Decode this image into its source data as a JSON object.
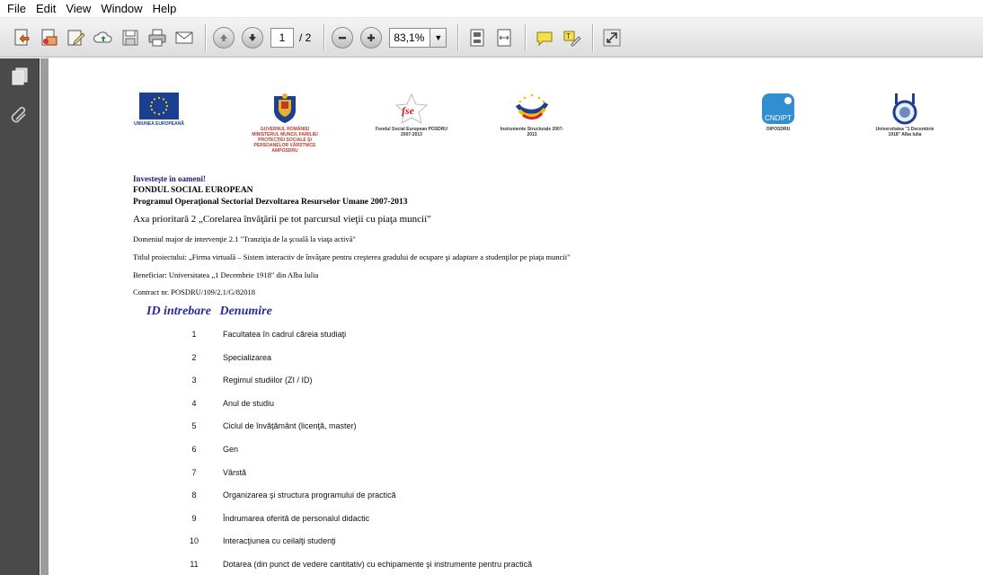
{
  "menu": [
    "File",
    "Edit",
    "View",
    "Window",
    "Help"
  ],
  "toolbar": {
    "page_current": "1",
    "page_total": "/ 2",
    "zoom": "83,1%"
  },
  "logos": {
    "eu": "UNIUNEA EUROPEANĂ",
    "gov": "GUVERNUL ROMÂNIEI MINISTERUL MUNCII, FAMILIEI PROTECȚIEI SOCIALE ȘI PERSOANELOR VÂRSTNICE AMPOSDRU",
    "fse": "Fondul Social European POSDRU 2007-2013",
    "is": "Instrumente Structurale 2007-2013",
    "cndipt_mark": "CNDIPT",
    "cndipt": "OIPOSDRU",
    "uab": "Universitatea \"1 Decembrie 1918\" Alba Iulia"
  },
  "header": {
    "invest": "Investeşte în oameni!",
    "fonds": "FONDUL SOCIAL EUROPEAN",
    "program": "Programul Operaţional Sectorial Dezvoltarea Resurselor Umane 2007-2013",
    "axa": "Axa prioritară 2 „Corelarea învăţării pe tot parcursul vieţii cu piaţa muncii\"",
    "domeniu": "Domeniul major de intervenţie 2.1 \"Tranziţia de la şcoală la viaţa activă\"",
    "titlu": "Titlul proiectului: „Firma virtuală – Sistem interactiv de învăţare pentru creşterea gradului de ocupare şi adaptare a studenţilor pe piaţa muncii\"",
    "beneficiar": "Beneficiar: Universitatea „1 Decembrie 1918\" din Alba Iulia",
    "contract": "Contract nr. POSDRU/109/2.1/G/82018"
  },
  "table": {
    "col_id": "ID intrebare",
    "col_name": "Denumire",
    "rows": [
      {
        "id": "1",
        "name": "Facultatea în cadrul căreia studiaţi"
      },
      {
        "id": "2",
        "name": "Specializarea"
      },
      {
        "id": "3",
        "name": "Regimul studiilor (ZI / ID)"
      },
      {
        "id": "4",
        "name": "Anul de studiu"
      },
      {
        "id": "5",
        "name": "Ciclul de învăţământ (licenţă, master)"
      },
      {
        "id": "6",
        "name": "Gen"
      },
      {
        "id": "7",
        "name": "Vârstă"
      },
      {
        "id": "8",
        "name": "Organizarea şi structura programului de practică"
      },
      {
        "id": "9",
        "name": "Îndrumarea oferită de personalul didactic"
      },
      {
        "id": "10",
        "name": "Interacţiunea cu ceilalţi studenţi"
      },
      {
        "id": "11",
        "name": "Dotarea (din punct de vedere cantitativ) cu echipamente şi instrumente pentru practică"
      }
    ]
  }
}
